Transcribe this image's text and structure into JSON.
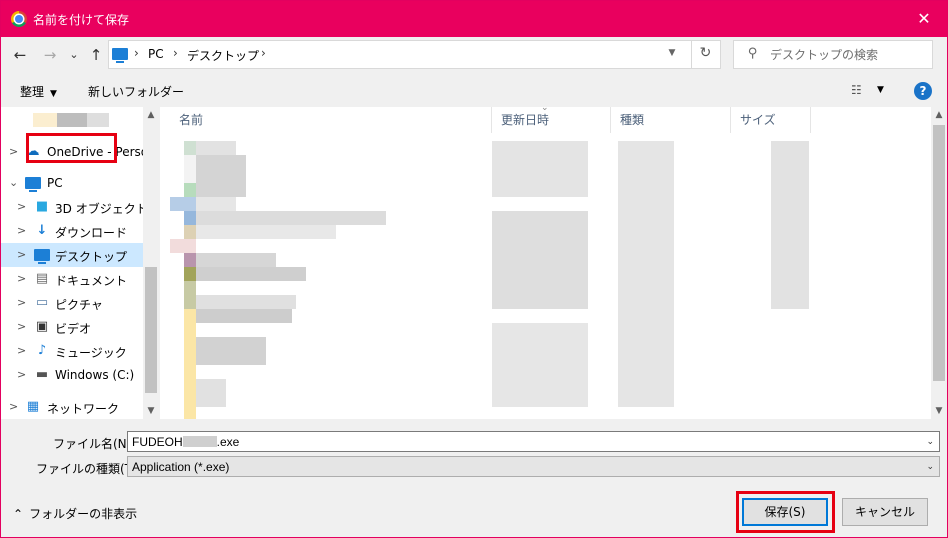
{
  "window": {
    "title": "名前を付けて保存",
    "close_icon": "✕"
  },
  "nav": {
    "back_icon": "←",
    "forward_icon": "→",
    "recent_icon": "⌄",
    "up_icon": "↑",
    "breadcrumb": [
      "PC",
      "デスクトップ"
    ],
    "separator": "›",
    "refresh_icon": "↻"
  },
  "search": {
    "placeholder": "デスクトップの検索"
  },
  "toolbar": {
    "organize": "整理",
    "new_folder": "新しいフォルダー",
    "help": "?"
  },
  "tree": {
    "items": [
      {
        "label": "OneDrive - Person"
      },
      {
        "label": "PC"
      },
      {
        "label": "3D オブジェクト"
      },
      {
        "label": "ダウンロード"
      },
      {
        "label": "デスクトップ"
      },
      {
        "label": "ドキュメント"
      },
      {
        "label": "ピクチャ"
      },
      {
        "label": "ビデオ"
      },
      {
        "label": "ミュージック"
      },
      {
        "label": "Windows (C:)"
      },
      {
        "label": "ネットワーク"
      }
    ]
  },
  "columns": {
    "name": "名前",
    "date": "更新日時",
    "type": "種類",
    "size": "サイズ"
  },
  "fields": {
    "filename_label": "ファイル名(N):",
    "filename_prefix": "FUDEOH",
    "filename_suffix": ".exe",
    "filetype_label": "ファイルの種類(T):",
    "filetype_value": "Application (*.exe)"
  },
  "footer": {
    "hide_folders": "フォルダーの非表示",
    "save": "保存(S)",
    "cancel": "キャンセル"
  },
  "colors": {
    "titlebar": "#e9005e",
    "highlight": "#e60012",
    "selection": "#cce8ff",
    "accent": "#0078d7"
  }
}
